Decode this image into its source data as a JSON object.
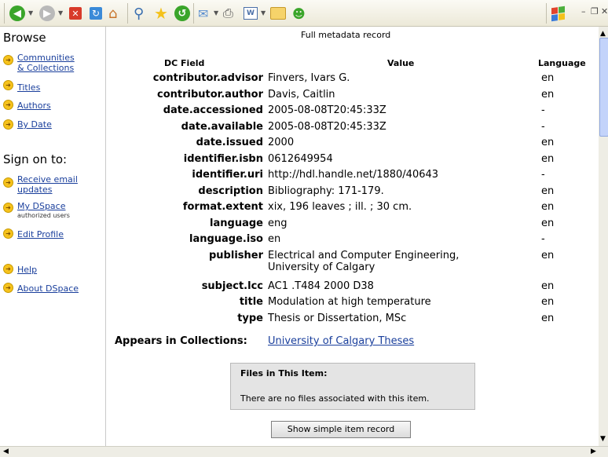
{
  "toolbar": {
    "icons": [
      "back-icon",
      "forward-icon",
      "stop-icon",
      "refresh-icon",
      "home-icon",
      "search-icon",
      "favorites-icon",
      "history-icon",
      "mail-icon",
      "print-icon",
      "word-icon",
      "folder-icon",
      "messenger-icon",
      "windows-logo-icon"
    ],
    "colors": {
      "back": "#3aa52a",
      "stop": "#d83a2a",
      "star": "#f4c21c",
      "folder": "#f6d36a"
    }
  },
  "sidebar": {
    "browse_heading": "Browse",
    "browse_items": [
      {
        "label_lines": [
          "Communities",
          "& Collections"
        ]
      },
      {
        "label": "Titles"
      },
      {
        "label": "Authors"
      },
      {
        "label": "By Date"
      }
    ],
    "signon_heading": "Sign on to:",
    "signon_items": [
      {
        "label_lines": [
          "Receive email",
          "updates"
        ]
      },
      {
        "label": "My DSpace",
        "note": "authorized users"
      },
      {
        "label": "Edit Profile"
      }
    ],
    "help_items": [
      {
        "label": "Help"
      },
      {
        "label": "About DSpace"
      }
    ]
  },
  "record": {
    "title": "Full metadata record",
    "col_field": "DC Field",
    "col_value": "Value",
    "col_language": "Language",
    "rows": [
      {
        "field": "contributor.advisor",
        "value": "Finvers, Ivars G.",
        "lang": "en"
      },
      {
        "field": "contributor.author",
        "value": "Davis, Caitlin",
        "lang": "en"
      },
      {
        "field": "date.accessioned",
        "value": "2005-08-08T20:45:33Z",
        "lang": "-"
      },
      {
        "field": "date.available",
        "value": "2005-08-08T20:45:33Z",
        "lang": "-"
      },
      {
        "field": "date.issued",
        "value": "2000",
        "lang": "en"
      },
      {
        "field": "identifier.isbn",
        "value": "0612649954",
        "lang": "en"
      },
      {
        "field": "identifier.uri",
        "value": "http://hdl.handle.net/1880/40643",
        "lang": "-"
      },
      {
        "field": "description",
        "value": "Bibliography: 171-179.",
        "lang": "en"
      },
      {
        "field": "format.extent",
        "value": "xix, 196 leaves ; ill. ; 30 cm.",
        "lang": "en"
      },
      {
        "field": "language",
        "value": "eng",
        "lang": "en"
      },
      {
        "field": "language.iso",
        "value": "en",
        "lang": "-"
      },
      {
        "field": "publisher",
        "value_lines": [
          "Electrical and Computer Engineering,",
          "University of Calgary"
        ],
        "lang": "en"
      },
      {
        "field": "subject.lcc",
        "value": "AC1 .T484 2000 D38",
        "lang": "en"
      },
      {
        "field": "title",
        "value": "Modulation at high temperature",
        "lang": "en"
      },
      {
        "field": "type",
        "value": "Thesis or Dissertation, MSc",
        "lang": "en"
      }
    ],
    "appears_label": "Appears in Collections:",
    "appears_link": "University of Calgary Theses"
  },
  "files": {
    "heading": "Files in This Item:",
    "message": "There are no files associated with this item."
  },
  "simple_button": "Show simple item record",
  "window_controls": [
    "-",
    "Ε",
    "×"
  ]
}
